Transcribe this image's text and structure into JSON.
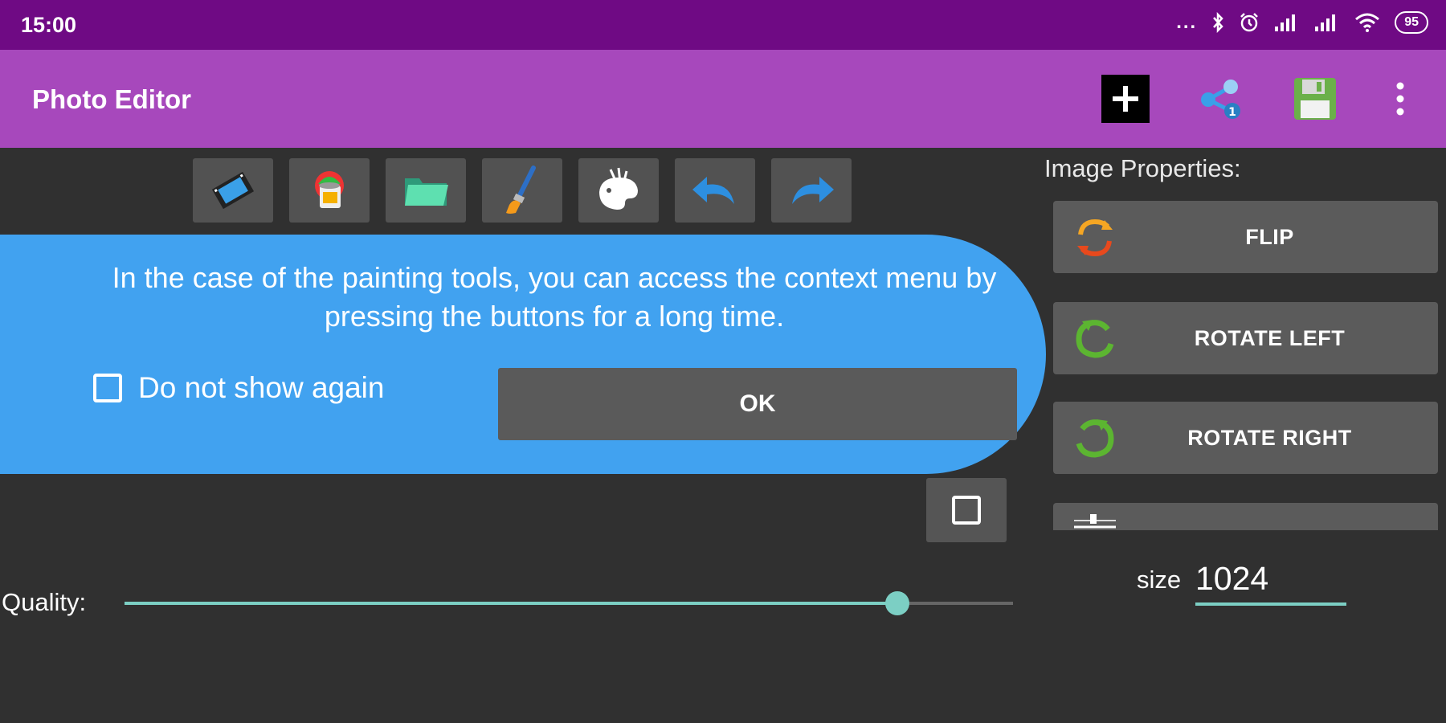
{
  "status_bar": {
    "time": "15:00",
    "battery": "95",
    "dots": "...",
    "icons": [
      "bluetooth-icon",
      "alarm-icon",
      "signal-icon",
      "signal-icon",
      "wifi-icon",
      "battery-icon"
    ]
  },
  "app_bar": {
    "title": "Photo Editor",
    "actions": [
      "add-icon",
      "share-icon",
      "save-icon",
      "more-icon"
    ]
  },
  "toolbar": {
    "tools": [
      "video-icon",
      "paint-bucket-icon",
      "folder-icon",
      "brush-icon",
      "palette-icon",
      "undo-icon",
      "redo-icon"
    ]
  },
  "properties": {
    "title": "Image Properties:",
    "buttons": [
      {
        "label": "FLIP",
        "icon": "flip-icon"
      },
      {
        "label": "ROTATE LEFT",
        "icon": "rotate-left-icon"
      },
      {
        "label": "ROTATE RIGHT",
        "icon": "rotate-right-icon"
      }
    ]
  },
  "dialog": {
    "message": "In the case of the painting tools, you can access the context menu by pressing the buttons for a long time.",
    "checkbox_label": "Do not show again",
    "ok_label": "OK"
  },
  "quality": {
    "label": "Quality:",
    "value": 0.87
  },
  "size": {
    "label": "size",
    "value": "1024"
  },
  "colors": {
    "status_bar": "#6f0a84",
    "app_bar": "#a748bc",
    "dialog": "#41a2f0",
    "accent": "#7ccfc4",
    "background": "#303030"
  }
}
